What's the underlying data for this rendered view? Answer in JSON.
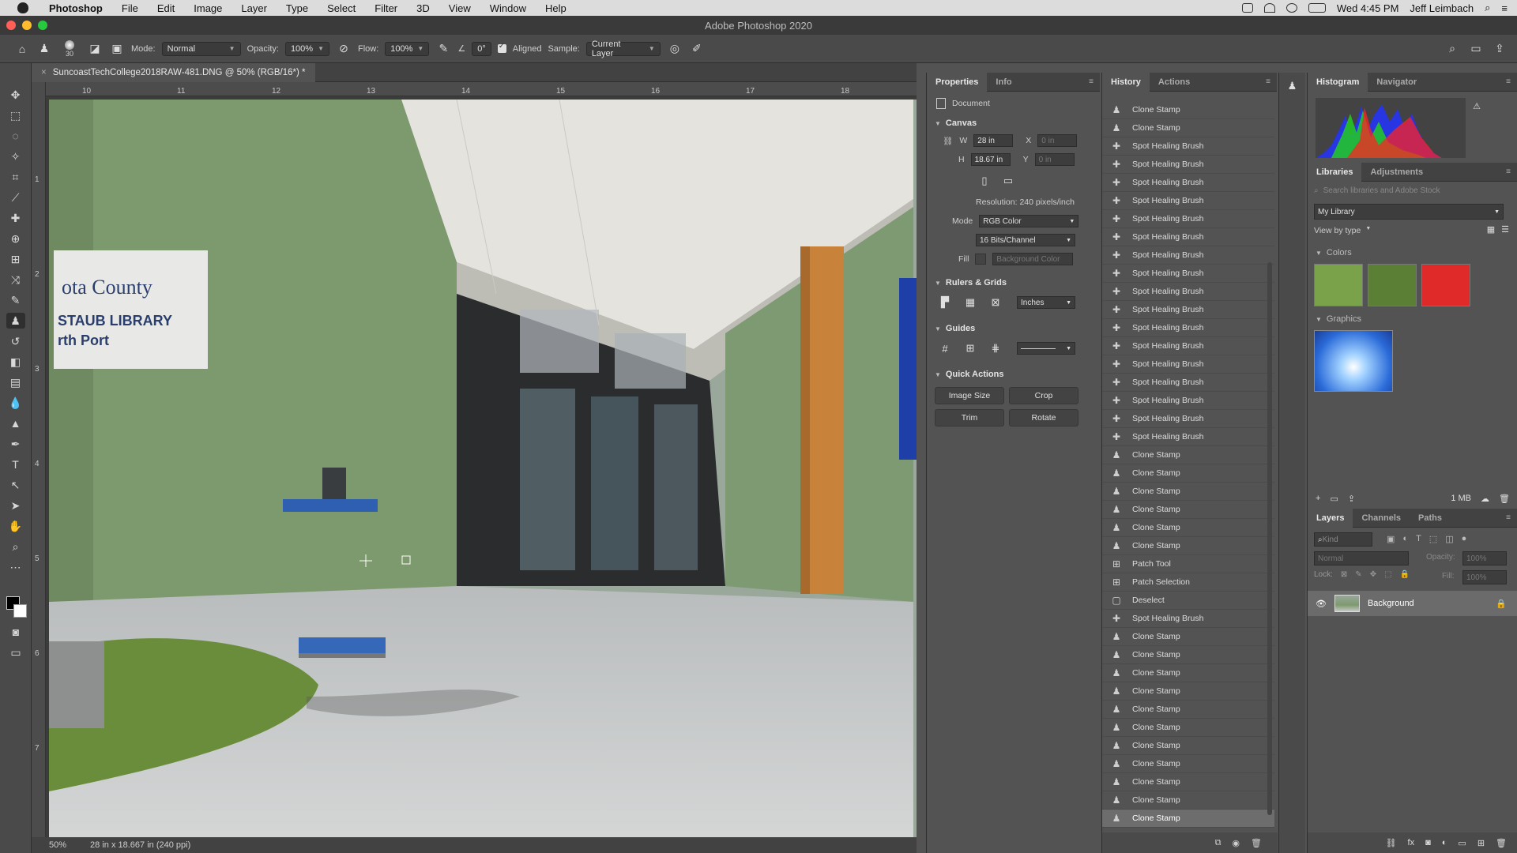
{
  "menubar": {
    "app": "Photoshop",
    "items": [
      "File",
      "Edit",
      "Image",
      "Layer",
      "Type",
      "Select",
      "Filter",
      "3D",
      "View",
      "Window",
      "Help"
    ],
    "clock": "Wed 4:45 PM",
    "user": "Jeff Leimbach"
  },
  "titlebar": {
    "title": "Adobe Photoshop 2020"
  },
  "options": {
    "brush_size": "30",
    "mode_label": "Mode:",
    "mode_value": "Normal",
    "opacity_label": "Opacity:",
    "opacity_value": "100%",
    "flow_label": "Flow:",
    "flow_value": "100%",
    "angle_value": "0°",
    "aligned_label": "Aligned",
    "sample_label": "Sample:",
    "sample_value": "Current Layer"
  },
  "document": {
    "tab_title": "SuncoastTechCollege2018RAW-481.DNG @ 50% (RGB/16*) *",
    "zoom": "50%",
    "dimensions": "28 in x 18.667 in (240 ppi)",
    "ruler_top": [
      "10",
      "11",
      "12",
      "13",
      "14",
      "15",
      "16",
      "17",
      "18"
    ],
    "ruler_left": [
      "1",
      "2",
      "3",
      "4",
      "5",
      "6",
      "7"
    ],
    "sign_lines": [
      "ota County",
      "STAUB LIBRARY",
      "rth Port"
    ]
  },
  "properties": {
    "tabs": [
      "Properties",
      "Info"
    ],
    "doc_label": "Document",
    "canvas_title": "Canvas",
    "w_label": "W",
    "w_value": "28 in",
    "h_label": "H",
    "h_value": "18.67 in",
    "x_label": "X",
    "x_value": "0 in",
    "y_label": "Y",
    "y_value": "0 in",
    "resolution": "Resolution: 240 pixels/inch",
    "mode_label": "Mode",
    "mode_value": "RGB Color",
    "depth_value": "16 Bits/Channel",
    "fill_label": "Fill",
    "fill_value": "Background Color",
    "rulers_title": "Rulers & Grids",
    "units_value": "Inches",
    "guides_title": "Guides",
    "quick_title": "Quick Actions",
    "btn_image_size": "Image Size",
    "btn_crop": "Crop",
    "btn_trim": "Trim",
    "btn_rotate": "Rotate"
  },
  "history": {
    "tabs": [
      "History",
      "Actions"
    ],
    "items": [
      {
        "label": "Clone Stamp",
        "icon": "clone-stamp-icon"
      },
      {
        "label": "Clone Stamp",
        "icon": "clone-stamp-icon"
      },
      {
        "label": "Spot Healing Brush",
        "icon": "spot-healing-icon"
      },
      {
        "label": "Spot Healing Brush",
        "icon": "spot-healing-icon"
      },
      {
        "label": "Spot Healing Brush",
        "icon": "spot-healing-icon"
      },
      {
        "label": "Spot Healing Brush",
        "icon": "spot-healing-icon"
      },
      {
        "label": "Spot Healing Brush",
        "icon": "spot-healing-icon"
      },
      {
        "label": "Spot Healing Brush",
        "icon": "spot-healing-icon"
      },
      {
        "label": "Spot Healing Brush",
        "icon": "spot-healing-icon"
      },
      {
        "label": "Spot Healing Brush",
        "icon": "spot-healing-icon"
      },
      {
        "label": "Spot Healing Brush",
        "icon": "spot-healing-icon"
      },
      {
        "label": "Spot Healing Brush",
        "icon": "spot-healing-icon"
      },
      {
        "label": "Spot Healing Brush",
        "icon": "spot-healing-icon"
      },
      {
        "label": "Spot Healing Brush",
        "icon": "spot-healing-icon"
      },
      {
        "label": "Spot Healing Brush",
        "icon": "spot-healing-icon"
      },
      {
        "label": "Spot Healing Brush",
        "icon": "spot-healing-icon"
      },
      {
        "label": "Spot Healing Brush",
        "icon": "spot-healing-icon"
      },
      {
        "label": "Spot Healing Brush",
        "icon": "spot-healing-icon"
      },
      {
        "label": "Spot Healing Brush",
        "icon": "spot-healing-icon"
      },
      {
        "label": "Clone Stamp",
        "icon": "clone-stamp-icon"
      },
      {
        "label": "Clone Stamp",
        "icon": "clone-stamp-icon"
      },
      {
        "label": "Clone Stamp",
        "icon": "clone-stamp-icon"
      },
      {
        "label": "Clone Stamp",
        "icon": "clone-stamp-icon"
      },
      {
        "label": "Clone Stamp",
        "icon": "clone-stamp-icon"
      },
      {
        "label": "Clone Stamp",
        "icon": "clone-stamp-icon"
      },
      {
        "label": "Patch Tool",
        "icon": "patch-tool-icon"
      },
      {
        "label": "Patch Selection",
        "icon": "patch-tool-icon"
      },
      {
        "label": "Deselect",
        "icon": "deselect-icon"
      },
      {
        "label": "Spot Healing Brush",
        "icon": "spot-healing-icon"
      },
      {
        "label": "Clone Stamp",
        "icon": "clone-stamp-icon"
      },
      {
        "label": "Clone Stamp",
        "icon": "clone-stamp-icon"
      },
      {
        "label": "Clone Stamp",
        "icon": "clone-stamp-icon"
      },
      {
        "label": "Clone Stamp",
        "icon": "clone-stamp-icon"
      },
      {
        "label": "Clone Stamp",
        "icon": "clone-stamp-icon"
      },
      {
        "label": "Clone Stamp",
        "icon": "clone-stamp-icon"
      },
      {
        "label": "Clone Stamp",
        "icon": "clone-stamp-icon"
      },
      {
        "label": "Clone Stamp",
        "icon": "clone-stamp-icon"
      },
      {
        "label": "Clone Stamp",
        "icon": "clone-stamp-icon"
      },
      {
        "label": "Clone Stamp",
        "icon": "clone-stamp-icon"
      },
      {
        "label": "Clone Stamp",
        "icon": "clone-stamp-icon"
      }
    ]
  },
  "histogram": {
    "tabs": [
      "Histogram",
      "Navigator"
    ]
  },
  "libraries": {
    "tabs": [
      "Libraries",
      "Adjustments"
    ],
    "search_placeholder": "Search libraries and Adobe Stock",
    "library_name": "My Library",
    "view_by": "View by type",
    "colors_title": "Colors",
    "colors": [
      "#79a24a",
      "#5a7f35",
      "#e02a2a"
    ],
    "graphics_title": "Graphics",
    "size_label": "1 MB"
  },
  "layers": {
    "tabs": [
      "Layers",
      "Channels",
      "Paths"
    ],
    "kind_placeholder": "Kind",
    "blend_mode": "Normal",
    "opacity_label": "Opacity:",
    "opacity_value": "100%",
    "lock_label": "Lock:",
    "fill_label": "Fill:",
    "fill_value": "100%",
    "layer_name": "Background"
  },
  "colors": {
    "panel_bg": "#535353",
    "history_selected": "#6d6d6d",
    "wall_green": "#7d9a6e",
    "column_orange": "#c8823a"
  }
}
